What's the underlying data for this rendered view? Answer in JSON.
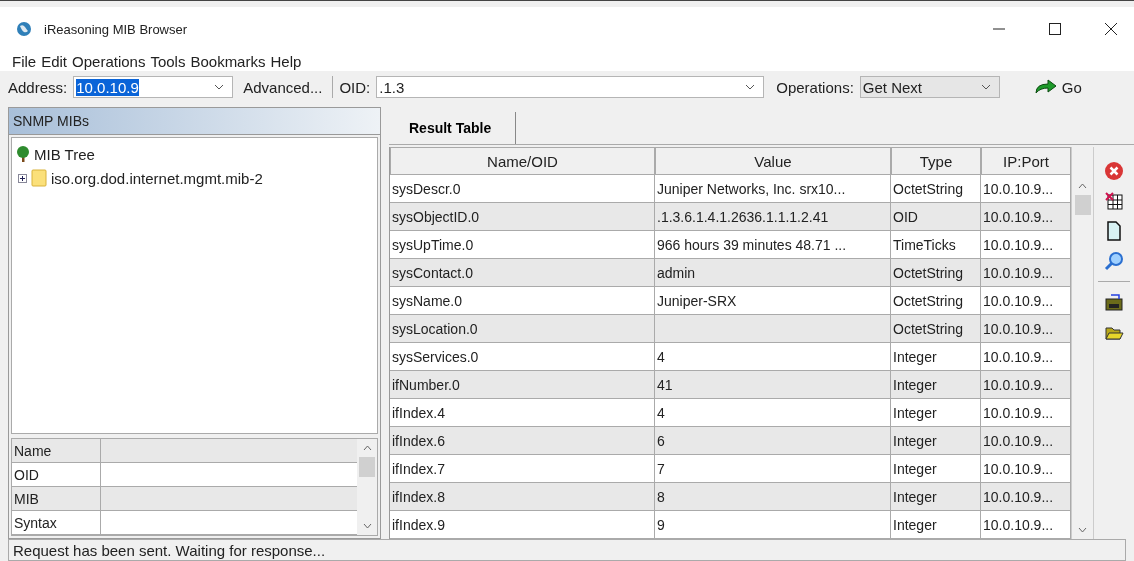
{
  "window": {
    "title": "iReasoning MIB Browser"
  },
  "menu": [
    "File",
    "Edit",
    "Operations",
    "Tools",
    "Bookmarks",
    "Help"
  ],
  "toolbar": {
    "address_label": "Address:",
    "address": {
      "value": "10.0.10.9",
      "highlighted": true
    },
    "advanced_button": "Advanced...",
    "oid_label": "OID:",
    "oid": ".1.3",
    "operations_label": "Operations:",
    "operation": "Get Next",
    "go_button": "Go"
  },
  "mib_panel": {
    "title": "SNMP MIBs",
    "tree": [
      {
        "label": "MIB Tree",
        "children": [
          {
            "label": "iso.org.dod.internet.mgmt.mib-2",
            "expanded": false
          }
        ]
      }
    ],
    "properties": [
      "Name",
      "OID",
      "MIB",
      "Syntax"
    ]
  },
  "tabs": [
    {
      "label": "Result Table",
      "selected": true
    }
  ],
  "table": {
    "columns": [
      "Name/OID",
      "Value",
      "Type",
      "IP:Port"
    ],
    "rows": [
      [
        "sysDescr.0",
        "Juniper Networks, Inc. srx10...",
        "OctetString",
        "10.0.10.9..."
      ],
      [
        "sysObjectID.0",
        ".1.3.6.1.4.1.2636.1.1.1.2.41",
        "OID",
        "10.0.10.9..."
      ],
      [
        "sysUpTime.0",
        "966 hours 39 minutes 48.71 ...",
        "TimeTicks",
        "10.0.10.9..."
      ],
      [
        "sysContact.0",
        "admin",
        "OctetString",
        "10.0.10.9..."
      ],
      [
        "sysName.0",
        "Juniper-SRX",
        "OctetString",
        "10.0.10.9..."
      ],
      [
        "sysLocation.0",
        "",
        "OctetString",
        "10.0.10.9..."
      ],
      [
        "sysServices.0",
        "4",
        "Integer",
        "10.0.10.9..."
      ],
      [
        "ifNumber.0",
        "41",
        "Integer",
        "10.0.10.9..."
      ],
      [
        "ifIndex.4",
        "4",
        "Integer",
        "10.0.10.9..."
      ],
      [
        "ifIndex.6",
        "6",
        "Integer",
        "10.0.10.9..."
      ],
      [
        "ifIndex.7",
        "7",
        "Integer",
        "10.0.10.9..."
      ],
      [
        "ifIndex.8",
        "8",
        "Integer",
        "10.0.10.9..."
      ],
      [
        "ifIndex.9",
        "9",
        "Integer",
        "10.0.10.9..."
      ]
    ]
  },
  "status_bar": "Request has been sent. Waiting for response..."
}
